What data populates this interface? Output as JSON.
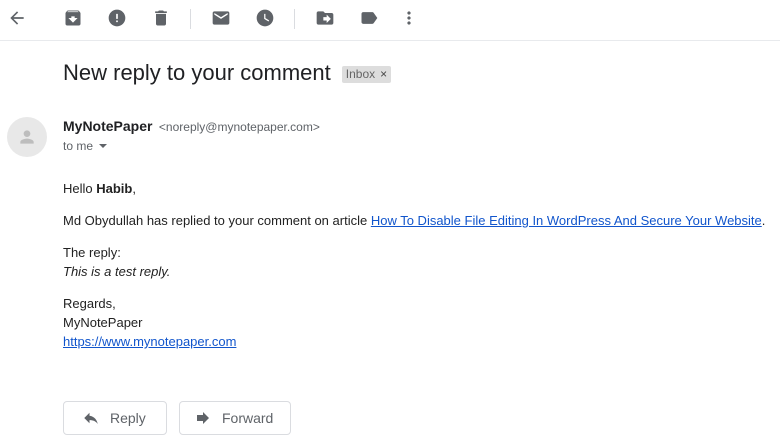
{
  "email": {
    "subject": "New reply to your comment",
    "label": "Inbox",
    "label_remove": "×",
    "sender_name": "MyNotePaper",
    "sender_email": "<noreply@mynotepaper.com>",
    "recipient": "to me",
    "greeting_prefix": "Hello ",
    "greeting_name": "Habib",
    "greeting_suffix": ",",
    "body_line": "Md Obydullah has replied to your comment on article ",
    "article_link": "How To Disable File Editing In WordPress And Secure Your Website",
    "body_line_end": ".",
    "reply_label": "The reply:",
    "reply_text": "This is a test reply.",
    "signoff": "Regards,",
    "signature_name": "MyNotePaper",
    "signature_link": "https://www.mynotepaper.com"
  },
  "actions": {
    "reply": "Reply",
    "forward": "Forward"
  },
  "toolbar": {
    "icons": [
      "back-arrow-icon",
      "archive-icon",
      "report-spam-icon",
      "delete-icon",
      "mark-unread-icon",
      "snooze-icon",
      "move-to-icon",
      "labels-icon",
      "more-options-icon"
    ]
  }
}
